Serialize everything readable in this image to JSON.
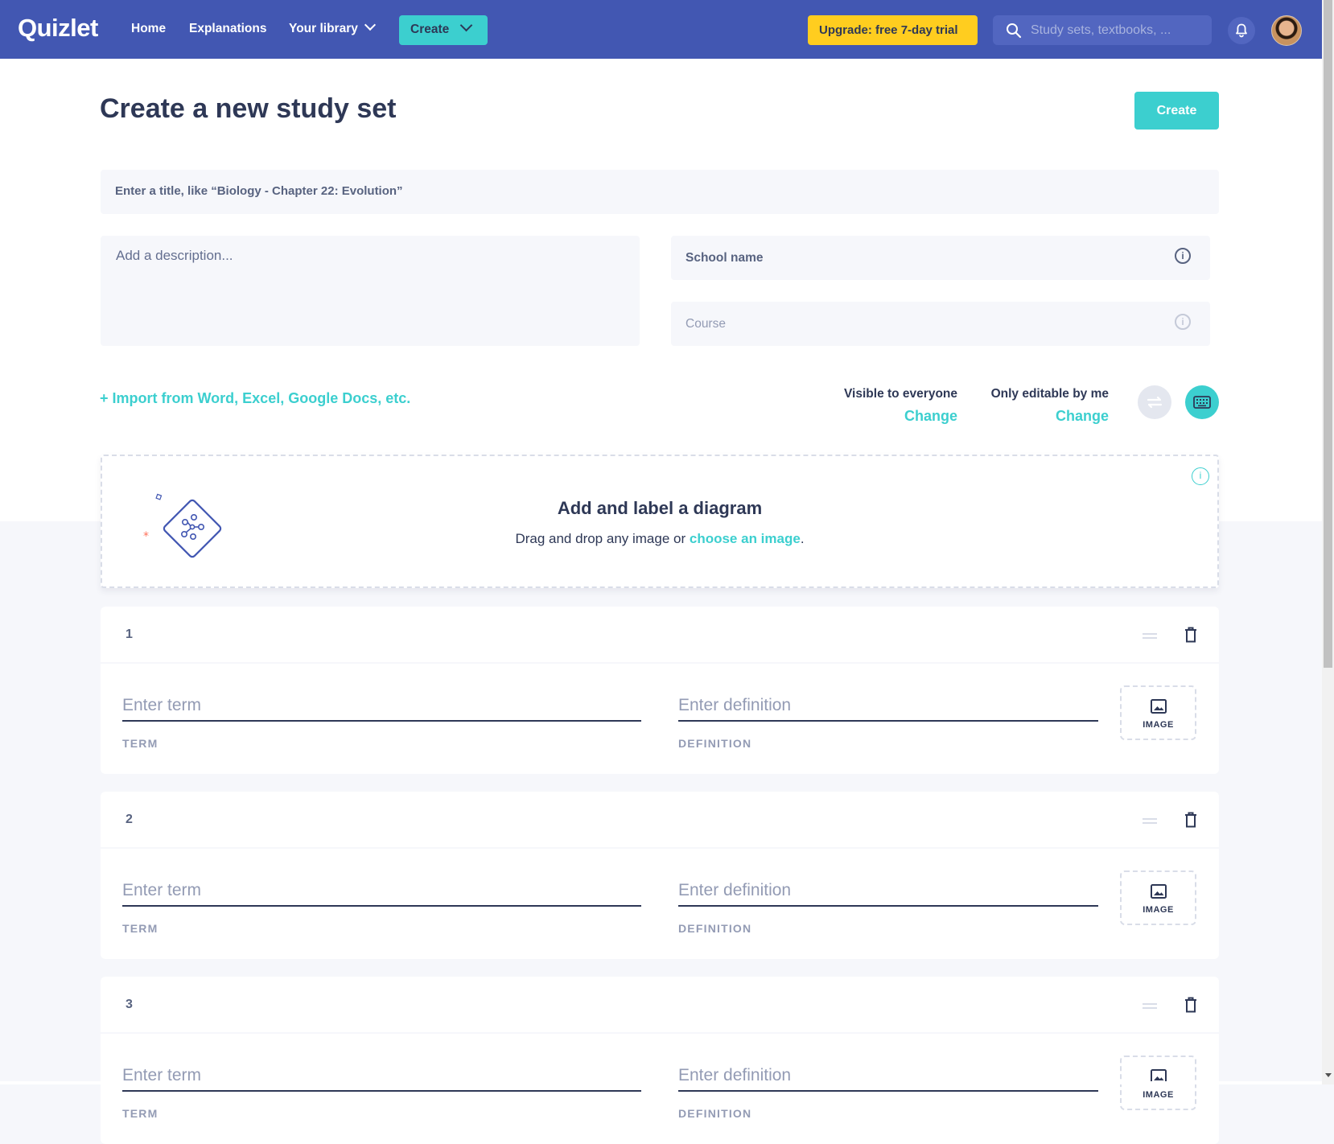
{
  "nav": {
    "logo": "Quizlet",
    "home": "Home",
    "explanations": "Explanations",
    "library": "Your library",
    "create": "Create",
    "upgrade": "Upgrade: free 7-day trial",
    "search_placeholder": "Study sets, textbooks, ..."
  },
  "page": {
    "title": "Create a new study set",
    "create_button": "Create",
    "title_placeholder": "Enter a title, like “Biology - Chapter 22: Evolution”",
    "description_placeholder": "Add a description...",
    "school_placeholder": "School name",
    "course_placeholder": "Course",
    "import_link": "+ Import from Word, Excel, Google Docs, etc.",
    "visibility_label": "Visible to everyone",
    "visibility_change": "Change",
    "editable_label": "Only editable by me",
    "editable_change": "Change"
  },
  "diagram": {
    "title": "Add and label a diagram",
    "subtitle_prefix": "Drag and drop any image or",
    "subtitle_link": "choose an image",
    "subtitle_suffix": "."
  },
  "cards": [
    {
      "number": "1",
      "term_placeholder": "Enter term",
      "definition_placeholder": "Enter definition",
      "term_label": "TERM",
      "definition_label": "DEFINITION",
      "image_label": "IMAGE"
    },
    {
      "number": "2",
      "term_placeholder": "Enter term",
      "definition_placeholder": "Enter definition",
      "term_label": "TERM",
      "definition_label": "DEFINITION",
      "image_label": "IMAGE"
    },
    {
      "number": "3",
      "term_placeholder": "Enter term",
      "definition_placeholder": "Enter definition",
      "term_label": "TERM",
      "definition_label": "DEFINITION",
      "image_label": "IMAGE"
    }
  ],
  "colors": {
    "brand": "#4257b2",
    "accent": "#3ccfcf",
    "upgrade": "#ffcd1f"
  },
  "icons": [
    "search-icon",
    "bell-icon",
    "info-icon",
    "swap-icon",
    "keyboard-icon",
    "diagram-icon",
    "drag-handle-icon",
    "trash-icon",
    "image-icon",
    "chevron-down-icon"
  ]
}
